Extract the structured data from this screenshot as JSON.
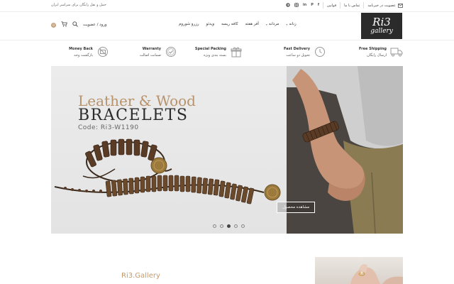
{
  "topbar": {
    "left_text": "حمل و نقل رایگان برای سراسر ایران",
    "membership": "عضویت در خبرنامه",
    "contact": "تماس با ما",
    "rules": "قوانین",
    "social": [
      "f",
      "in",
      "P",
      "O",
      "T"
    ]
  },
  "header": {
    "logo_line1": "Ri3",
    "logo_line2": "gallery",
    "nav": [
      {
        "label": "زنانه",
        "has_dropdown": true
      },
      {
        "label": "مردانه",
        "has_dropdown": true
      },
      {
        "label": "آفر هفته",
        "has_dropdown": false
      },
      {
        "label": "کافه ریسه",
        "has_dropdown": false
      },
      {
        "label": "ویدئو",
        "has_dropdown": false
      },
      {
        "label": "رزرو شوروم",
        "has_dropdown": false
      }
    ],
    "login_label": "ورود / عضویت",
    "cart_count": "0"
  },
  "features": [
    {
      "title": "Free Shipping",
      "subtitle": "ارسال رایگان",
      "icon": "truck-icon"
    },
    {
      "title": "Fast Delivery",
      "subtitle": "تحویل دو ساعت",
      "icon": "clock-icon"
    },
    {
      "title": "Special Packing",
      "subtitle": "بسته بندی ویژه",
      "icon": "gift-icon"
    },
    {
      "title": "Warranty",
      "subtitle": "ضمانت اصالت",
      "icon": "badge-check-icon"
    },
    {
      "title": "Money Back",
      "subtitle": "بازگشت وجه",
      "icon": "money-back-icon"
    }
  ],
  "hero": {
    "title_line1": "Leather & Wood",
    "title_line2": "BRACELETS",
    "code": "Code: Ri3-W1190",
    "cta_label": "مشاهده محصول",
    "slide_count": 5,
    "active_slide": 3
  },
  "bottom": {
    "brand": "Ri3.Gallery"
  },
  "colors": {
    "accent": "#c49a6c",
    "logo_bg": "#2b2b2b",
    "dark_text": "#2c2c2c"
  }
}
